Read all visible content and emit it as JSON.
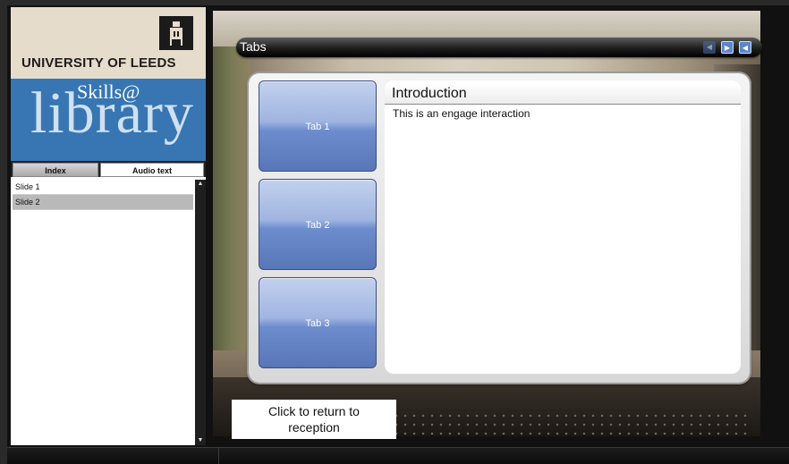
{
  "sidebar": {
    "university_name": "UNIVERSITY OF LEEDS",
    "brand_prefix": "Skills@",
    "brand_word": "library",
    "tabs": [
      {
        "label": "Index"
      },
      {
        "label": "Audio text"
      }
    ],
    "slides": [
      {
        "label": "Slide 1",
        "selected": false
      },
      {
        "label": "Slide 2",
        "selected": true
      }
    ],
    "scroll_up_icon": "▲",
    "scroll_down_icon": "▼"
  },
  "stage": {
    "title": "Tabs",
    "controls": {
      "prev_icon": "◀",
      "next_icon": "▶",
      "audio_icon": "◀"
    },
    "tabs": [
      {
        "label": "Tab 1"
      },
      {
        "label": "Tab 2"
      },
      {
        "label": "Tab 3"
      }
    ],
    "content": {
      "heading": "Introduction",
      "body": "This is an engage interaction"
    },
    "return_button": {
      "line1": "Click to return to",
      "line2": "reception"
    }
  },
  "colors": {
    "brand_blue": "#3776b2",
    "tab_blue": "#6d8ccd",
    "titlebar": "#1d1d1d"
  }
}
